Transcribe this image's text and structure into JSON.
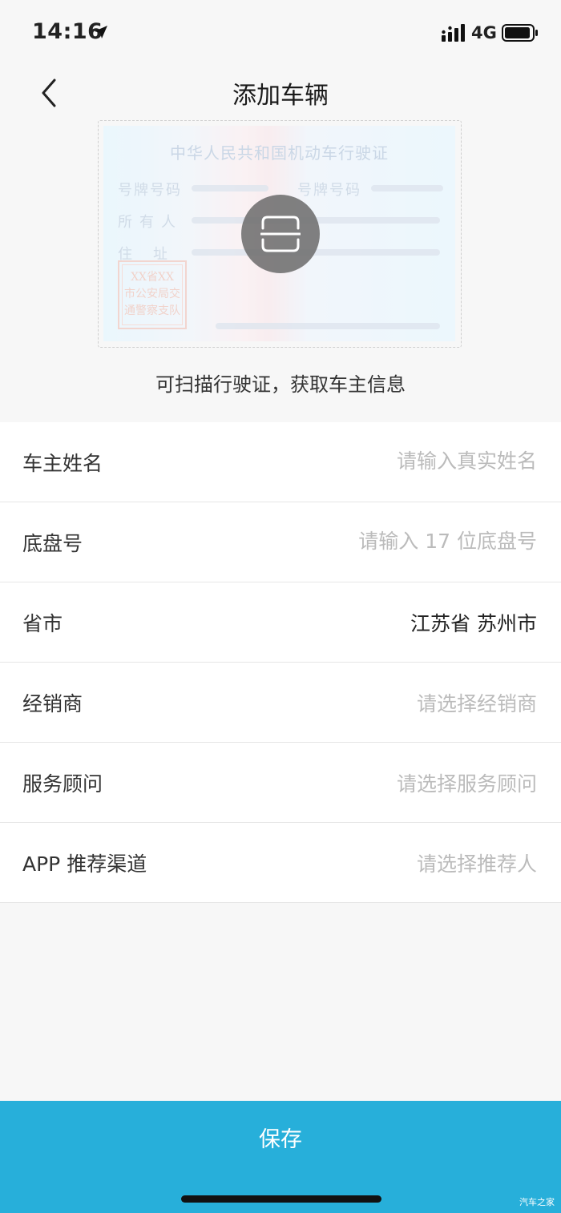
{
  "status_bar": {
    "time": "14:16",
    "network": "4G"
  },
  "header": {
    "title": "添加车辆"
  },
  "license_card": {
    "title": "中华人民共和国机动车行驶证",
    "label_plate_type": "号牌号码",
    "label_plate_no": "号牌号码",
    "label_owner": "所有人",
    "label_address": "住址",
    "stamp_lines": [
      "XX省XX",
      "市公安局交",
      "通警察支队"
    ]
  },
  "scan": {
    "hint": "可扫描行驶证，获取车主信息"
  },
  "form": {
    "owner_name": {
      "label": "车主姓名",
      "placeholder": "请输入真实姓名"
    },
    "vin": {
      "label": "底盘号",
      "placeholder": "请输入 17 位底盘号"
    },
    "province_city": {
      "label": "省市",
      "value": "江苏省 苏州市"
    },
    "dealer": {
      "label": "经销商",
      "placeholder": "请选择经销商"
    },
    "advisor": {
      "label": "服务顾问",
      "placeholder": "请选择服务顾问"
    },
    "referral": {
      "label": "APP 推荐渠道",
      "placeholder": "请选择推荐人"
    }
  },
  "footer": {
    "save_label": "保存",
    "watermark": "汽车之家"
  },
  "colors": {
    "accent": "#27afda",
    "background": "#f7f7f7",
    "placeholder": "#bbbbbb"
  },
  "icons": {
    "back": "chevron-left-icon",
    "scan": "scan-card-icon",
    "location": "location-arrow-icon",
    "signal": "signal-icon",
    "battery": "battery-icon"
  }
}
